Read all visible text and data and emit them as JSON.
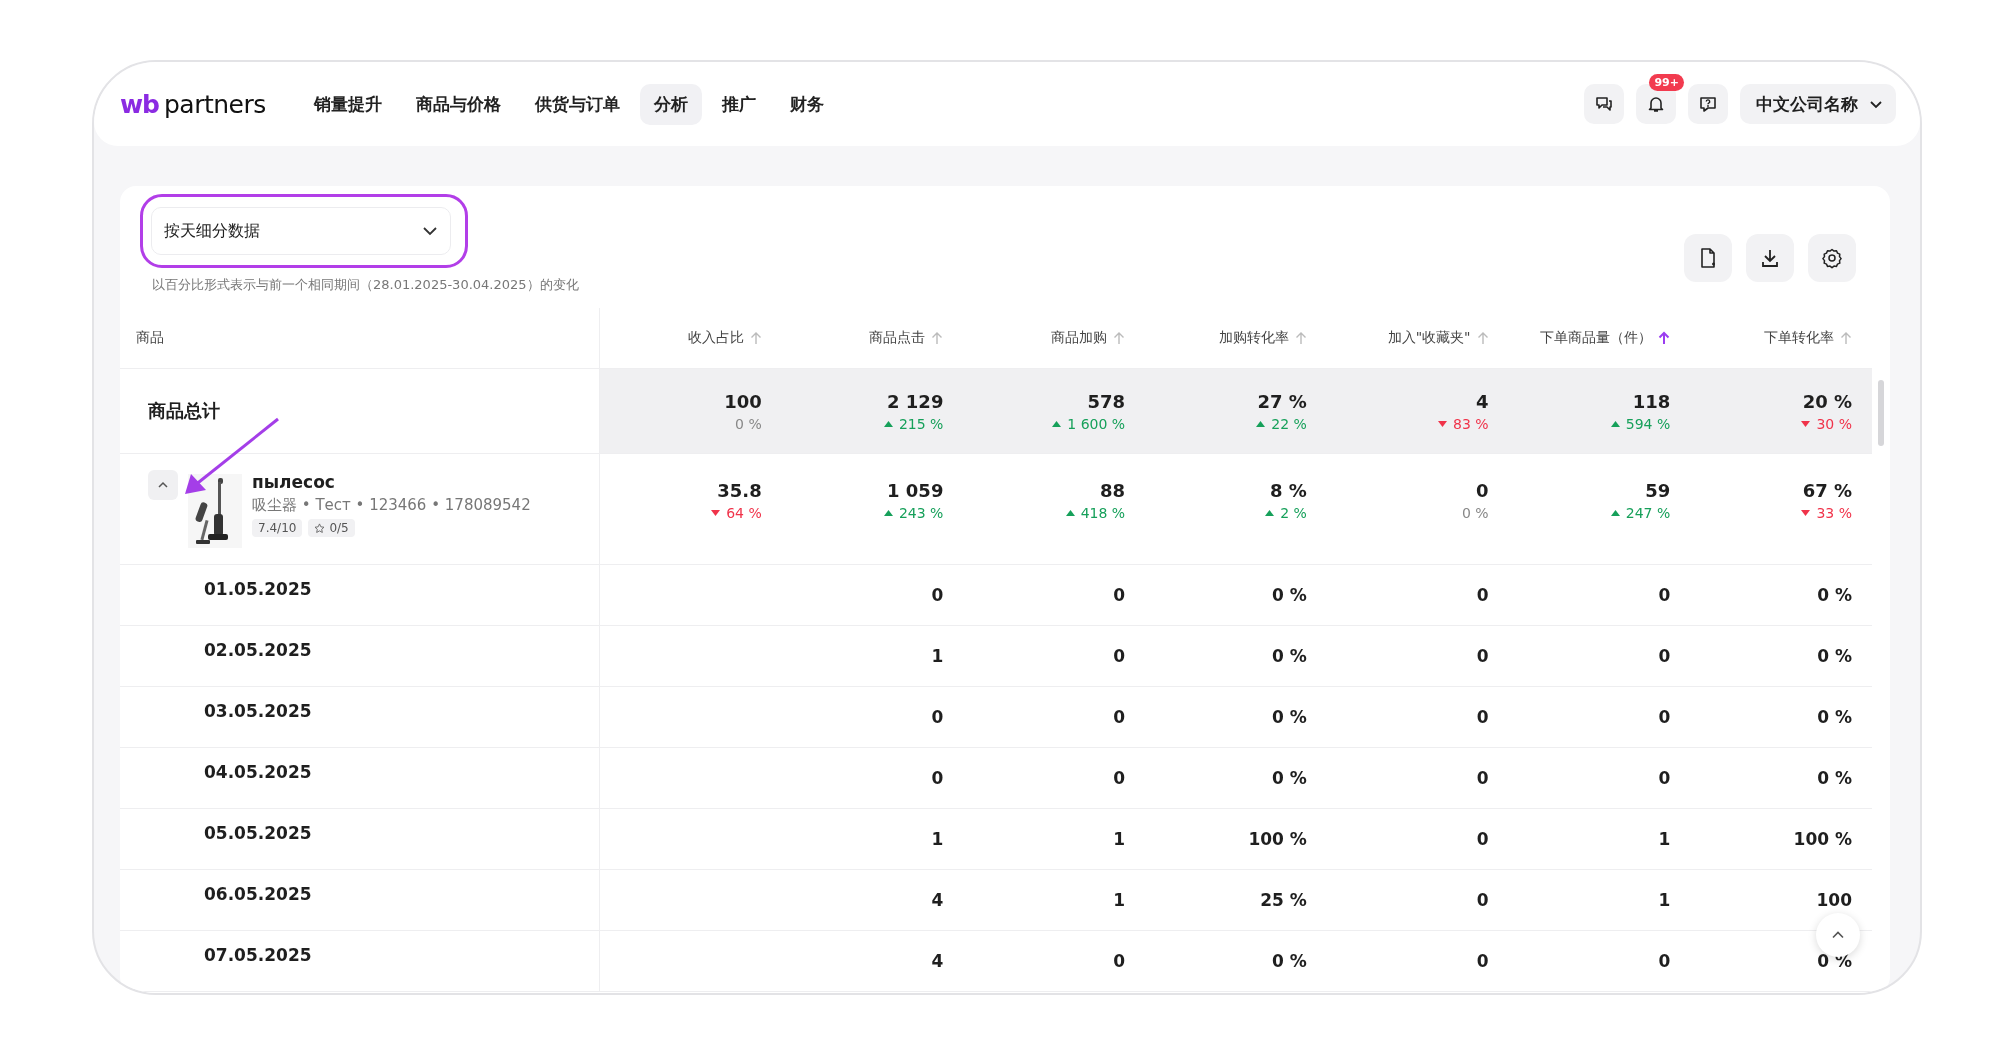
{
  "header": {
    "logo_mark": "wb",
    "logo_text": "partners",
    "nav": [
      {
        "label": "销量提升",
        "selected": false
      },
      {
        "label": "商品与价格",
        "selected": false
      },
      {
        "label": "供货与订单",
        "selected": false
      },
      {
        "label": "分析",
        "selected": true
      },
      {
        "label": "推广",
        "selected": false
      },
      {
        "label": "财务",
        "selected": false
      }
    ],
    "notification_badge": "99+",
    "company": "中文公司名称"
  },
  "toolbar": {
    "dropdown": "按天细分数据",
    "note": "以百分比形式表示与前一个相同期间（28.01.2025-30.04.2025）的变化"
  },
  "table": {
    "columns": [
      {
        "label": "商品"
      },
      {
        "label": "收入占比",
        "sorted": false
      },
      {
        "label": "商品点击",
        "sorted": false
      },
      {
        "label": "商品加购",
        "sorted": false
      },
      {
        "label": "加购转化率",
        "sorted": false
      },
      {
        "label": "加入\"收藏夹\"",
        "sorted": false
      },
      {
        "label": "下单商品量（件）",
        "sorted": true
      },
      {
        "label": "下单转化率",
        "sorted": false
      }
    ],
    "total": {
      "label": "商品总计",
      "cells": [
        {
          "value": "100",
          "change": "0 %",
          "kind": "flat"
        },
        {
          "value": "2 129",
          "change": "215 %",
          "kind": "up"
        },
        {
          "value": "578",
          "change": "1 600 %",
          "kind": "up"
        },
        {
          "value": "27 %",
          "change": "22 %",
          "kind": "up"
        },
        {
          "value": "4",
          "change": "83 %",
          "kind": "down"
        },
        {
          "value": "118",
          "change": "594 %",
          "kind": "up"
        },
        {
          "value": "20 %",
          "change": "30 %",
          "kind": "down"
        }
      ]
    },
    "product": {
      "name": "пылесос",
      "meta": "吸尘器 • Тест • 123466 • 178089542",
      "score": "7.4/10",
      "rating": "0/5",
      "expanded": true,
      "cells": [
        {
          "value": "35.8",
          "change": "64 %",
          "kind": "down"
        },
        {
          "value": "1 059",
          "change": "243 %",
          "kind": "up"
        },
        {
          "value": "88",
          "change": "418 %",
          "kind": "up"
        },
        {
          "value": "8 %",
          "change": "2 %",
          "kind": "up"
        },
        {
          "value": "0",
          "change": "0 %",
          "kind": "flat"
        },
        {
          "value": "59",
          "change": "247 %",
          "kind": "up"
        },
        {
          "value": "67 %",
          "change": "33 %",
          "kind": "down"
        }
      ]
    },
    "days": [
      {
        "date": "01.05.2025",
        "values": [
          "0",
          "0",
          "0 %",
          "0",
          "0",
          "0 %"
        ]
      },
      {
        "date": "02.05.2025",
        "values": [
          "1",
          "0",
          "0 %",
          "0",
          "0",
          "0 %"
        ]
      },
      {
        "date": "03.05.2025",
        "values": [
          "0",
          "0",
          "0 %",
          "0",
          "0",
          "0 %"
        ]
      },
      {
        "date": "04.05.2025",
        "values": [
          "0",
          "0",
          "0 %",
          "0",
          "0",
          "0 %"
        ]
      },
      {
        "date": "05.05.2025",
        "values": [
          "1",
          "1",
          "100 %",
          "0",
          "1",
          "100 %"
        ]
      },
      {
        "date": "06.05.2025",
        "values": [
          "4",
          "1",
          "25 %",
          "0",
          "1",
          "100"
        ]
      },
      {
        "date": "07.05.2025",
        "values": [
          "4",
          "0",
          "0 %",
          "0",
          "0",
          "0 %"
        ]
      }
    ]
  }
}
